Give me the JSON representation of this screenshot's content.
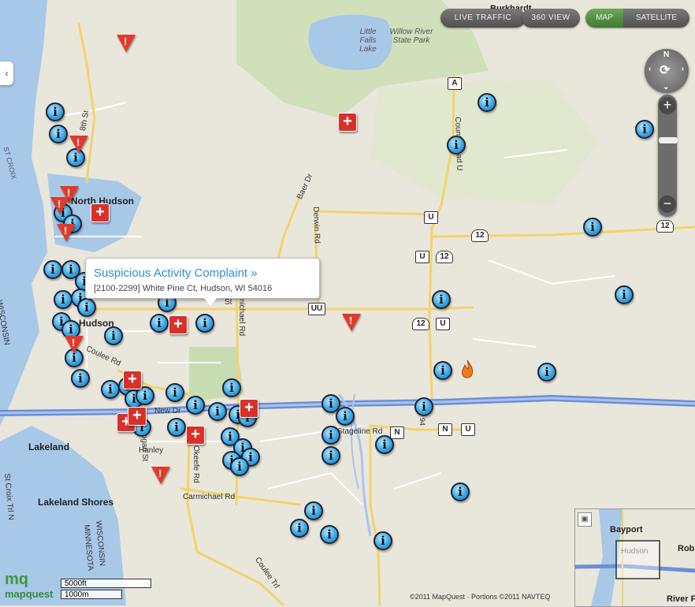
{
  "controls": {
    "live_traffic": "LIVE TRAFFIC",
    "view_360": "360 VIEW",
    "map": "MAP",
    "satellite": "SATELLITE",
    "compass_n": "N"
  },
  "popup": {
    "title": "Suspicious Activity Complaint »",
    "address": "[2100-2299] White Pine Ct, Hudson, WI 54016"
  },
  "places": {
    "north_hudson": "North Hudson",
    "hudson": "Hudson",
    "lakeland": "Lakeland",
    "lakeland_shores": "Lakeland Shores",
    "little_falls_lake": "Little Falls Lake",
    "willow_river": "Willow River State Park",
    "burkhardt": "Burkhardt",
    "wisconsin": "WISCONSIN",
    "minnesota": "MINNESOTA",
    "st_croix": "ST CROIX",
    "stcroix_trl": "St Croix Trl N"
  },
  "roads": {
    "baer_dr": "Baer Dr",
    "derwin_rd": "Derwin Rd",
    "county_road_u": "County Road U",
    "michael_rd": "Carmichael Rd",
    "carmichael_rd": "Carmichael Rd",
    "okeefe_rd": "Okeefe Rd",
    "stageline_rd": "Stageline Rd",
    "coulee_rd": "Coulee Rd",
    "coulee_trl": "Coulee Trl",
    "eighth_st": "8th St",
    "hanley": "Hanley",
    "new_dr": "New Dr",
    "st": "St",
    "logan_st": "Logan St"
  },
  "shields": {
    "a": "A",
    "u": "U",
    "uu": "UU",
    "n": "N",
    "twelve": "12",
    "i94": "94"
  },
  "overview": {
    "bayport": "Bayport",
    "hudson": "Hudson",
    "roberts": "Rob",
    "river_falls": "River F"
  },
  "scale": {
    "feet": "5000ft",
    "meters": "1000m"
  },
  "logo": "mapquest",
  "copyright": "©2011 MapQuest · Portions ©2011 NAVTEQ",
  "colors": {
    "info_marker": "#3aa9e6",
    "alert_marker": "#e23a2a",
    "hospital_marker": "#d9312a",
    "water": "#a8c8e8",
    "park": "#c8dcb4",
    "map_active": "#4f8a3a"
  }
}
